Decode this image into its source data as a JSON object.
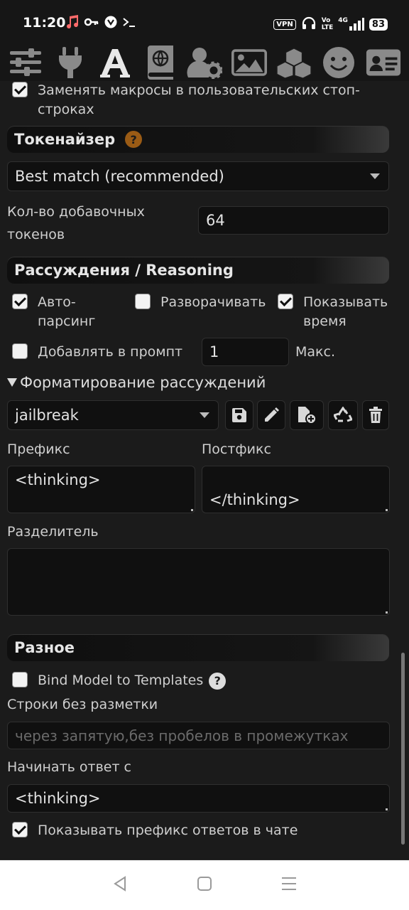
{
  "status_bar": {
    "time": "11:20",
    "vpn": "VPN",
    "volte_top": "Vo",
    "volte_bottom": "LTE",
    "network": "4G",
    "battery": "83"
  },
  "toolbar": {
    "icons": [
      "sliders-icon",
      "plug-icon",
      "font-icon",
      "book-globe-icon",
      "user-gear-icon",
      "image-icon",
      "cubes-icon",
      "smiley-icon",
      "id-card-icon"
    ]
  },
  "top_checkbox": {
    "checked": true,
    "label_line1": "Заменять макросы в пользовательских стоп-",
    "label_line2": "строках"
  },
  "tokenizer": {
    "title": "Токенайзер",
    "help": "?",
    "select_value": "Best match (recommended)",
    "extra_tokens_label_line1": "Кол-во добавочных",
    "extra_tokens_label_line2": "токенов",
    "extra_tokens_value": "64"
  },
  "reasoning": {
    "title": "Рассуждения / Reasoning",
    "auto_parse_line1": "Авто-",
    "auto_parse_line2": "парсинг",
    "expand_label": "Разворачивать",
    "show_time_line1": "Показывать",
    "show_time_line2": "время",
    "add_to_prompt_label": "Добавлять в промпт",
    "max_value": "1",
    "max_label": "Макс.",
    "formatting_title": "Форматирование рассуждений",
    "preset_value": "jailbreak",
    "prefix_label": "Префикс",
    "prefix_value": "<thinking>",
    "postfix_label": "Постфикс",
    "postfix_value": "</thinking>",
    "separator_label": "Разделитель",
    "separator_value": ""
  },
  "misc": {
    "title": "Разное",
    "bind_model_label": "Bind Model to Templates",
    "help": "?",
    "strings_label": "Строки без разметки",
    "strings_placeholder": "через запятую,без пробелов в промежутках",
    "start_reply_label": "Начинать ответ с",
    "start_reply_value": "<thinking>",
    "show_prefix_label": "Показывать префикс ответов в чате"
  }
}
